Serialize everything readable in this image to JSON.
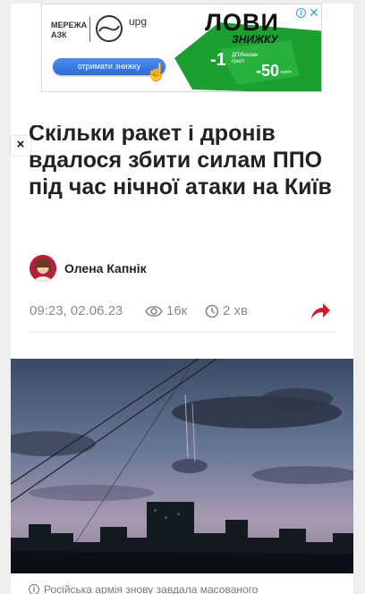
{
  "ad": {
    "brand": "МЕРЕЖА АЗК",
    "logo": "upg",
    "cta": "отримати знижку",
    "title": "ЛОВИ",
    "subtitle": "ЗНИЖКУ",
    "discount1": "-1",
    "discount1_unit": "грн/л",
    "discount1_note": "ДП/бензин",
    "discount2": "-50",
    "discount2_unit": "коп/л",
    "info_icon": "info-icon",
    "close_icon": "close-icon"
  },
  "article": {
    "title": "Скільки ракет і дронів вдалося збити силам ППО під час нічної атаки на Київ",
    "author": "Олена Капнік",
    "datetime": "09:23, 02.06.23",
    "views": "16к",
    "read_time": "2 хв",
    "caption": "Російська армія знову завдала масованого"
  },
  "overlay": {
    "close": "×"
  },
  "colors": {
    "ad_green": "#1aa031",
    "link_red": "#d0192c",
    "meta_gray": "#8a8a8a"
  }
}
